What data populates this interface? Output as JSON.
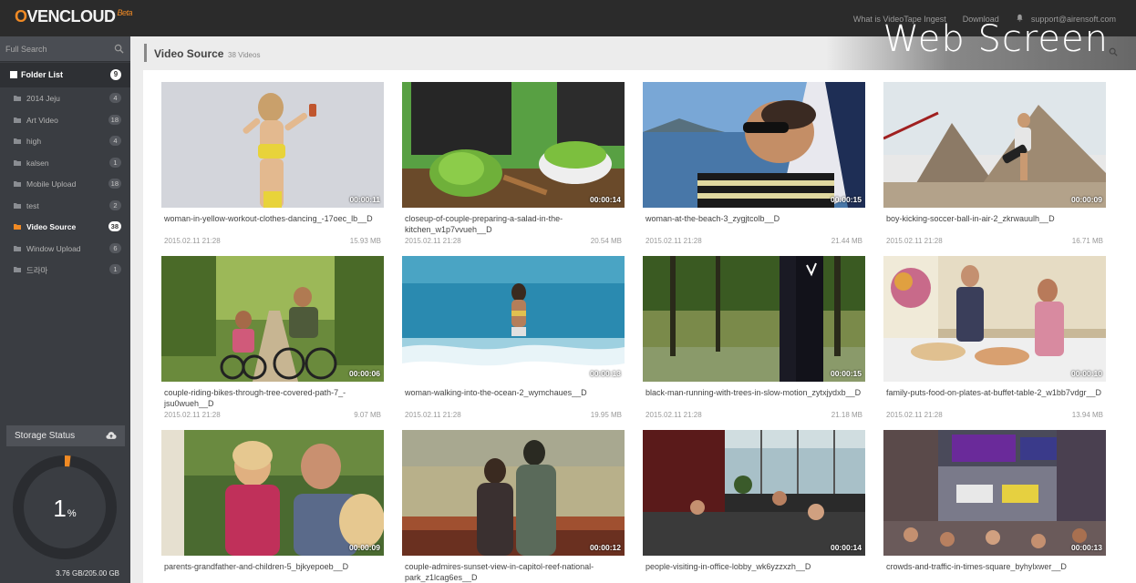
{
  "topbar": {
    "logo_prefix": "O",
    "logo_main": "VENCLOUD",
    "logo_beta": "Beta",
    "links": [
      "What is VideoTape Ingest",
      "Download"
    ],
    "user": "support@airensoft.com"
  },
  "sidebar": {
    "search_placeholder": "Full Search",
    "folder_list_label": "Folder List",
    "folder_list_count": "9",
    "folders": [
      {
        "name": "2014 Jeju",
        "count": "4"
      },
      {
        "name": "Art Video",
        "count": "18"
      },
      {
        "name": "high",
        "count": "4"
      },
      {
        "name": "kalsen",
        "count": "1"
      },
      {
        "name": "Mobile Upload",
        "count": "18"
      },
      {
        "name": "test",
        "count": "2"
      },
      {
        "name": "Video Source",
        "count": "38"
      },
      {
        "name": "Window Upload",
        "count": "6"
      },
      {
        "name": "드라마",
        "count": "1"
      }
    ],
    "active_folder": "Video Source",
    "storage_label": "Storage Status",
    "storage_percent_value": "1",
    "storage_percent_unit": "%",
    "storage_fraction": 0.0183,
    "storage_size": "3.76 GB/205.00 GB"
  },
  "main": {
    "title": "Video Source",
    "count": "38 Videos",
    "watermark": "Web Screen",
    "videos": [
      {
        "name": "woman-in-yellow-workout-clothes-dancing_-17oec_lb__D",
        "date": "2015.02.11 21:28",
        "size": "15.93 MB",
        "duration": "00:00:11"
      },
      {
        "name": "closeup-of-couple-preparing-a-salad-in-the-kitchen_w1p7vvueh__D",
        "date": "2015.02.11 21:28",
        "size": "20.54 MB",
        "duration": "00:00:14"
      },
      {
        "name": "woman-at-the-beach-3_zygjtcolb__D",
        "date": "2015.02.11 21:28",
        "size": "21.44 MB",
        "duration": "00:00:15"
      },
      {
        "name": "boy-kicking-soccer-ball-in-air-2_zkrwauulh__D",
        "date": "2015.02.11 21:28",
        "size": "16.71 MB",
        "duration": "00:00:09"
      },
      {
        "name": "couple-riding-bikes-through-tree-covered-path-7_-jsu0wueh__D",
        "date": "2015.02.11 21:28",
        "size": "9.07 MB",
        "duration": "00:00:06"
      },
      {
        "name": "woman-walking-into-the-ocean-2_wymchaues__D",
        "date": "2015.02.11 21:28",
        "size": "19.95 MB",
        "duration": "00:00:13"
      },
      {
        "name": "black-man-running-with-trees-in-slow-motion_zytxjydxb__D",
        "date": "2015.02.11 21:28",
        "size": "21.18 MB",
        "duration": "00:00:15"
      },
      {
        "name": "family-puts-food-on-plates-at-buffet-table-2_w1bb7vdgr__D",
        "date": "2015.02.11 21:28",
        "size": "13.94 MB",
        "duration": "00:00:10"
      },
      {
        "name": "parents-grandfather-and-children-5_bjkyepoeb__D",
        "date": "",
        "size": "",
        "duration": "00:00:09"
      },
      {
        "name": "couple-admires-sunset-view-in-capitol-reef-national-park_z1lcag6es__D",
        "date": "",
        "size": "",
        "duration": "00:00:12"
      },
      {
        "name": "people-visiting-in-office-lobby_wk6yzzxzh__D",
        "date": "",
        "size": "",
        "duration": "00:00:14"
      },
      {
        "name": "crowds-and-traffic-in-times-square_byhylxwer__D",
        "date": "",
        "size": "",
        "duration": "00:00:13"
      }
    ]
  },
  "colors": {
    "accent": "#f08a24",
    "topbar": "#2b2b2b",
    "sidebar": "#3a3d42"
  }
}
